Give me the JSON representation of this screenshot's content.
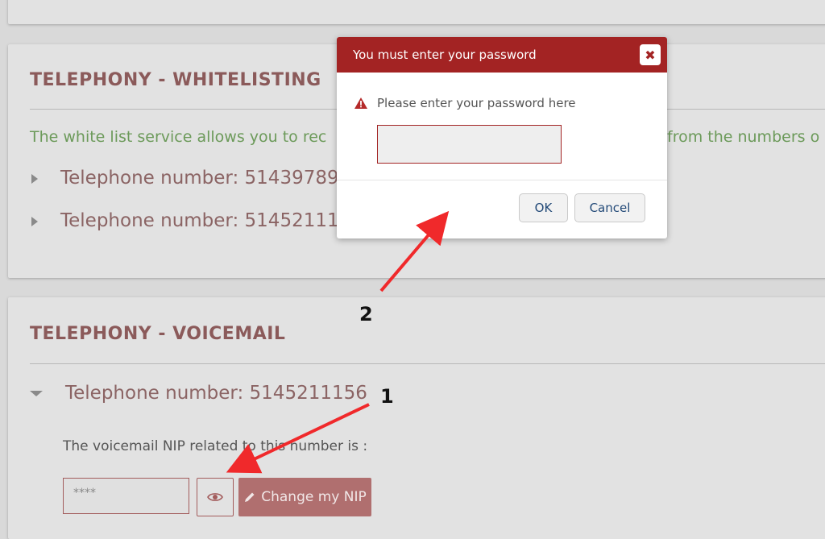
{
  "whitelist": {
    "title": "TELEPHONY - WHITELISTING",
    "description_start": "The white list service allows you to rec",
    "description_end": "from the numbers o",
    "phones": [
      "Telephone number: 5143978976",
      "Telephone number: 5145211156"
    ]
  },
  "voicemail": {
    "title": "TELEPHONY - VOICEMAIL",
    "phone": "Telephone number: 5145211156",
    "nip_text": "The voicemail NIP related to this number is :",
    "nip_value": "****",
    "change_label": "Change my NIP"
  },
  "dialog": {
    "title": "You must enter your password",
    "message": "Please enter your password here",
    "ok_label": "OK",
    "cancel_label": "Cancel"
  },
  "annotations": {
    "label_1": "1",
    "label_2": "2"
  },
  "colors": {
    "accent": "#a32323",
    "title": "#8b5a5a",
    "description": "#6c9a5a",
    "arrow": "#f0292b"
  }
}
